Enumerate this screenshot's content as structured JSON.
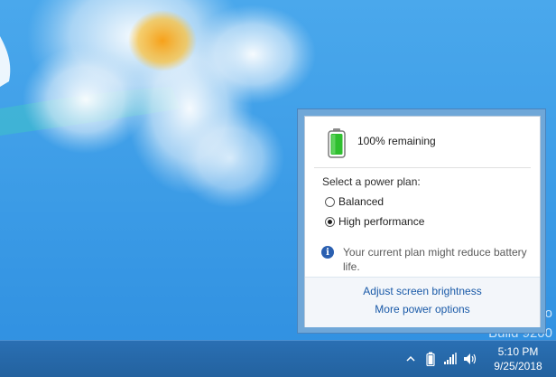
{
  "flyout": {
    "remaining": "100% remaining",
    "plan_label": "Select a power plan:",
    "plans": [
      {
        "label": "Balanced",
        "selected": false
      },
      {
        "label": "High performance",
        "selected": true
      }
    ],
    "info": "Your current plan might reduce battery life.",
    "links": {
      "brightness": "Adjust screen brightness",
      "more_options": "More power options"
    }
  },
  "watermark": {
    "line1": "o",
    "line2": "Build 9200"
  },
  "taskbar": {
    "clock": {
      "time": "5:10 PM",
      "date": "9/25/2018"
    },
    "icons": [
      "chevron-up-icon",
      "battery-icon",
      "network-icon",
      "volume-icon"
    ]
  },
  "colors": {
    "accent": "#1a5aa8",
    "battery_fill": "#2fbf2f",
    "taskbar": "#23629f",
    "desktop": "#3b9be6"
  }
}
